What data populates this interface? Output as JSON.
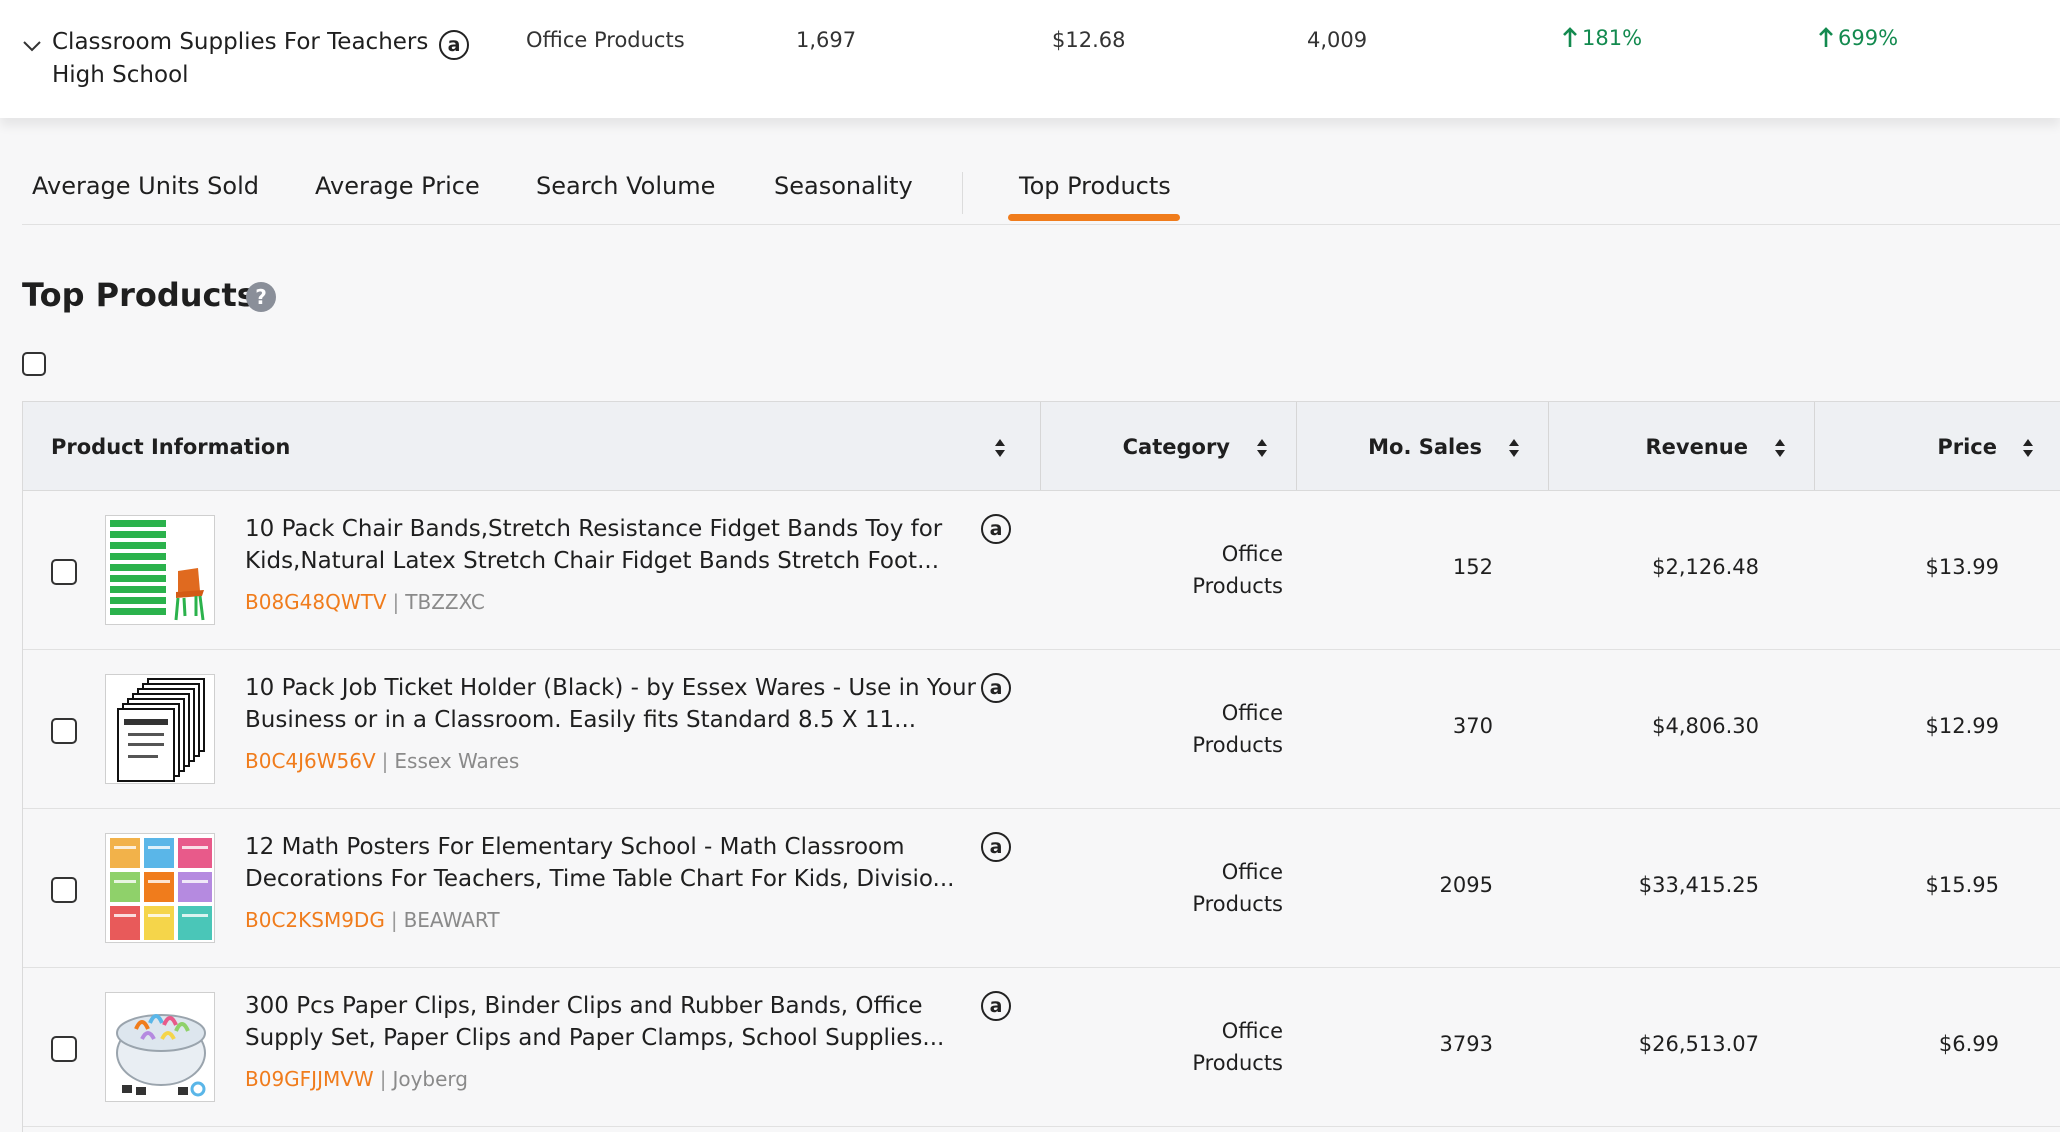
{
  "keyword_row": {
    "keyword": "Classroom Supplies For Teachers High School",
    "category": "Office Products",
    "search_volume": "1,697",
    "avg_price": "$12.68",
    "units": "4,009",
    "trend_1": "181%",
    "trend_2": "699%",
    "amazon_badge": "a",
    "trend_color": "#138a4f"
  },
  "tabs": [
    {
      "label": "Average Units Sold",
      "active": false
    },
    {
      "label": "Average Price",
      "active": false
    },
    {
      "label": "Search Volume",
      "active": false
    },
    {
      "label": "Seasonality",
      "active": false
    },
    {
      "label": "Top Products",
      "active": true
    }
  ],
  "accent_color": "#f07c1c",
  "section": {
    "title": "Top Products",
    "help_glyph": "?"
  },
  "table": {
    "headers": [
      "Product Information",
      "Category",
      "Mo. Sales",
      "Revenue",
      "Price"
    ],
    "rows": [
      {
        "title": "10 Pack Chair Bands,Stretch Resistance Fidget Bands Toy for Kids,Natural Latex Stretch Chair Fidget Bands Stretch Foot...",
        "asin": "B08G48QWTV",
        "brand": "TBZZXC",
        "category": "Office Products",
        "mo_sales": "152",
        "revenue": "$2,126.48",
        "price": "$13.99",
        "thumb": "green-chair-bands-image"
      },
      {
        "title": "10 Pack Job Ticket Holder (Black) - by Essex Wares - Use in Your Business or in a Classroom. Easily fits Standard 8.5 X 11...",
        "asin": "B0C4J6W56V",
        "brand": "Essex Wares",
        "category": "Office Products",
        "mo_sales": "370",
        "revenue": "$4,806.30",
        "price": "$12.99",
        "thumb": "job-ticket-holder-image"
      },
      {
        "title": "12 Math Posters For Elementary School - Math Classroom Decorations For Teachers, Time Table Chart For Kids, Divisio...",
        "asin": "B0C2KSM9DG",
        "brand": "BEAWART",
        "category": "Office Products",
        "mo_sales": "2095",
        "revenue": "$33,415.25",
        "price": "$15.95",
        "thumb": "math-posters-image"
      },
      {
        "title": "300 Pcs Paper Clips, Binder Clips and Rubber Bands, Office Supply Set, Paper Clips and Paper Clamps, School Supplies...",
        "asin": "B09GFJJMVW",
        "brand": "Joyberg",
        "category": "Office Products",
        "mo_sales": "3793",
        "revenue": "$26,513.07",
        "price": "$6.99",
        "thumb": "paper-clips-image"
      }
    ]
  }
}
